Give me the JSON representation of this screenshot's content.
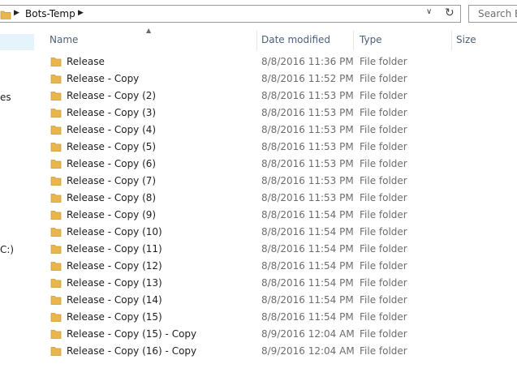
{
  "address_bar": {
    "breadcrumb": "Bots-Temp"
  },
  "search": {
    "placeholder": "Search Bo"
  },
  "nav_pane": {
    "fragments": [
      "es",
      "C:)"
    ]
  },
  "columns": {
    "name": "Name",
    "date_modified": "Date modified",
    "type": "Type",
    "size": "Size"
  },
  "files": [
    {
      "name": "Release",
      "date": "8/8/2016 11:36 PM",
      "type": "File folder"
    },
    {
      "name": "Release - Copy",
      "date": "8/8/2016 11:52 PM",
      "type": "File folder"
    },
    {
      "name": "Release - Copy (2)",
      "date": "8/8/2016 11:53 PM",
      "type": "File folder"
    },
    {
      "name": "Release - Copy (3)",
      "date": "8/8/2016 11:53 PM",
      "type": "File folder"
    },
    {
      "name": "Release - Copy (4)",
      "date": "8/8/2016 11:53 PM",
      "type": "File folder"
    },
    {
      "name": "Release - Copy (5)",
      "date": "8/8/2016 11:53 PM",
      "type": "File folder"
    },
    {
      "name": "Release - Copy (6)",
      "date": "8/8/2016 11:53 PM",
      "type": "File folder"
    },
    {
      "name": "Release - Copy (7)",
      "date": "8/8/2016 11:53 PM",
      "type": "File folder"
    },
    {
      "name": "Release - Copy (8)",
      "date": "8/8/2016 11:53 PM",
      "type": "File folder"
    },
    {
      "name": "Release - Copy (9)",
      "date": "8/8/2016 11:54 PM",
      "type": "File folder"
    },
    {
      "name": "Release - Copy (10)",
      "date": "8/8/2016 11:54 PM",
      "type": "File folder"
    },
    {
      "name": "Release - Copy (11)",
      "date": "8/8/2016 11:54 PM",
      "type": "File folder"
    },
    {
      "name": "Release - Copy (12)",
      "date": "8/8/2016 11:54 PM",
      "type": "File folder"
    },
    {
      "name": "Release - Copy (13)",
      "date": "8/8/2016 11:54 PM",
      "type": "File folder"
    },
    {
      "name": "Release - Copy (14)",
      "date": "8/8/2016 11:54 PM",
      "type": "File folder"
    },
    {
      "name": "Release - Copy (15)",
      "date": "8/8/2016 11:54 PM",
      "type": "File folder"
    },
    {
      "name": "Release - Copy (15) - Copy",
      "date": "8/9/2016 12:04 AM",
      "type": "File folder"
    },
    {
      "name": "Release - Copy (16) - Copy",
      "date": "8/9/2016 12:04 AM",
      "type": "File folder"
    }
  ],
  "colors": {
    "folder": "#e8b64a",
    "header_text": "#4c607a",
    "secondary_text": "#6d6d6d",
    "selection": "#e5f3fb"
  }
}
